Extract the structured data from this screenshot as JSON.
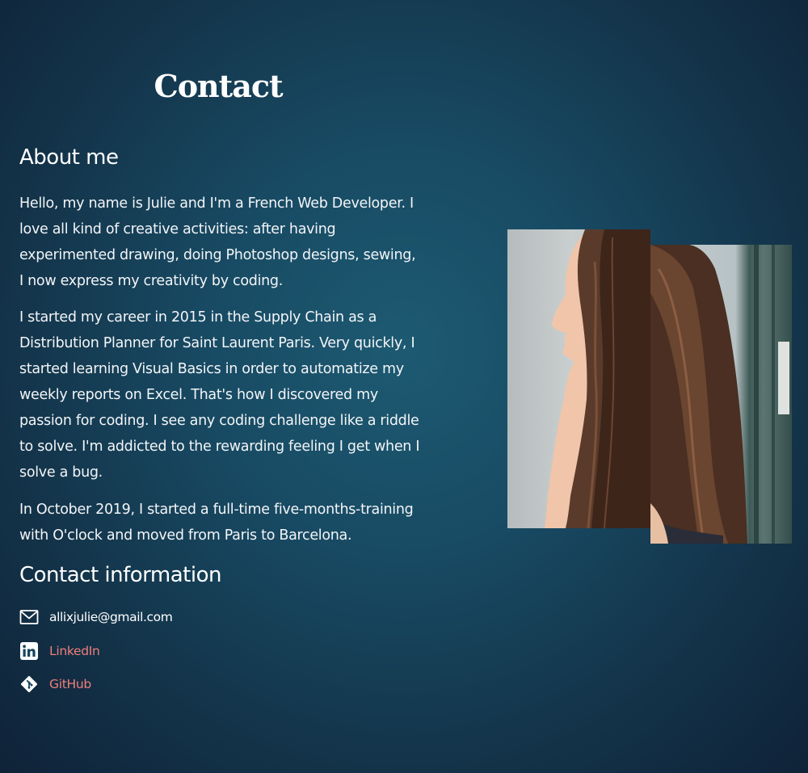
{
  "header": {
    "title": "Contact"
  },
  "about": {
    "heading": "About me",
    "paragraphs": [
      "Hello, my name is Julie and I'm a French Web Developer. I love all kind of creative activities: after having experimented drawing, doing Photoshop designs, sewing, I now express my creativity by coding.",
      "I started my career in 2015 in the Supply Chain as a Distribution Planner for Saint Laurent Paris. Very quickly, I started learning Visual Basics in order to automatize my weekly reports on Excel. That's how I discovered my passion for coding. I see any coding challenge like a riddle to solve. I'm addicted to the rewarding feeling I get when I solve a bug.",
      "In October 2019, I started a full-time five-months-training with O'clock and moved from Paris to Barcelona."
    ]
  },
  "contact": {
    "heading": "Contact information",
    "items": [
      {
        "icon": "envelope-icon",
        "label": "allixjulie@gmail.com"
      },
      {
        "icon": "linkedin-icon",
        "label": "LinkedIn"
      },
      {
        "icon": "git-icon",
        "label": "GitHub"
      }
    ]
  },
  "colors": {
    "background": "#184a63",
    "text": "#ffffff",
    "link": "#f07f7a"
  },
  "photo": {
    "subject": "portrait-profile-photo"
  }
}
